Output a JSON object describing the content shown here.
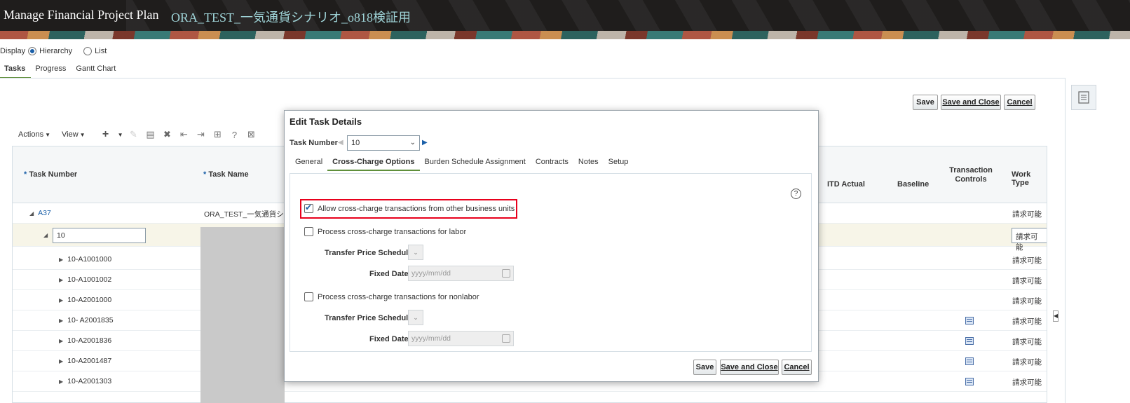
{
  "header": {
    "title": "Manage Financial Project Plan",
    "subtitle": "ORA_TEST_一気通貨シナリオ_o818検証用"
  },
  "display": {
    "label": "Display",
    "options": [
      "Hierarchy",
      "List"
    ],
    "selected": "Hierarchy"
  },
  "main_tabs": [
    "Tasks",
    "Progress",
    "Gantt Chart"
  ],
  "page_buttons": {
    "save": "Save",
    "save_close": "Save and Close",
    "cancel": "Cancel"
  },
  "toolbar": {
    "actions": "Actions",
    "view": "View"
  },
  "table": {
    "headers": {
      "task_number": "Task Number",
      "task_name": "Task Name",
      "itd_actual": "ITD Actual",
      "baseline": "Baseline",
      "transaction_controls_1": "Transaction",
      "transaction_controls_2": "Controls",
      "work_type": "Work Type"
    },
    "rows": [
      {
        "task_number": "A37",
        "task_name": "ORA_TEST_一気通貨シナ",
        "work_type": "請求可能"
      },
      {
        "task_number": "10",
        "task_name": "",
        "work_type": "請求可能"
      },
      {
        "task_number": "10-A1001000",
        "task_name": "",
        "work_type": "請求可能"
      },
      {
        "task_number": "10-A1001002",
        "task_name": "",
        "work_type": "請求可能"
      },
      {
        "task_number": "10-A2001000",
        "task_name": "",
        "work_type": "請求可能"
      },
      {
        "task_number": "10- A2001835",
        "task_name": "",
        "work_type": "請求可能"
      },
      {
        "task_number": "10-A2001836",
        "task_name": "",
        "work_type": "請求可能"
      },
      {
        "task_number": "10-A2001487",
        "task_name": "",
        "work_type": "請求可能"
      },
      {
        "task_number": "10-A2001303",
        "task_name": "",
        "work_type": "請求可能"
      }
    ]
  },
  "dialog": {
    "title": "Edit Task Details",
    "task_number_label": "Task Number",
    "task_number_value": "10",
    "tabs": [
      "General",
      "Cross-Charge Options",
      "Burden Schedule Assignment",
      "Contracts",
      "Notes",
      "Setup"
    ],
    "active_tab": "Cross-Charge Options",
    "allow_cross_charge": "Allow cross-charge transactions from other business units",
    "process_labor": "Process cross-charge transactions for labor",
    "process_nonlabor": "Process cross-charge transactions for nonlabor",
    "transfer_price_schedule": "Transfer Price Schedule",
    "fixed_date": "Fixed Date",
    "date_placeholder": "yyyy/mm/dd",
    "buttons": {
      "save": "Save",
      "save_close": "Save and Close",
      "cancel": "Cancel"
    }
  },
  "colors": {
    "accent": "#1a5fa8",
    "highlight": "#e8001c",
    "tab_underline": "#5f8f3a",
    "banner": "#1f1d1c"
  }
}
